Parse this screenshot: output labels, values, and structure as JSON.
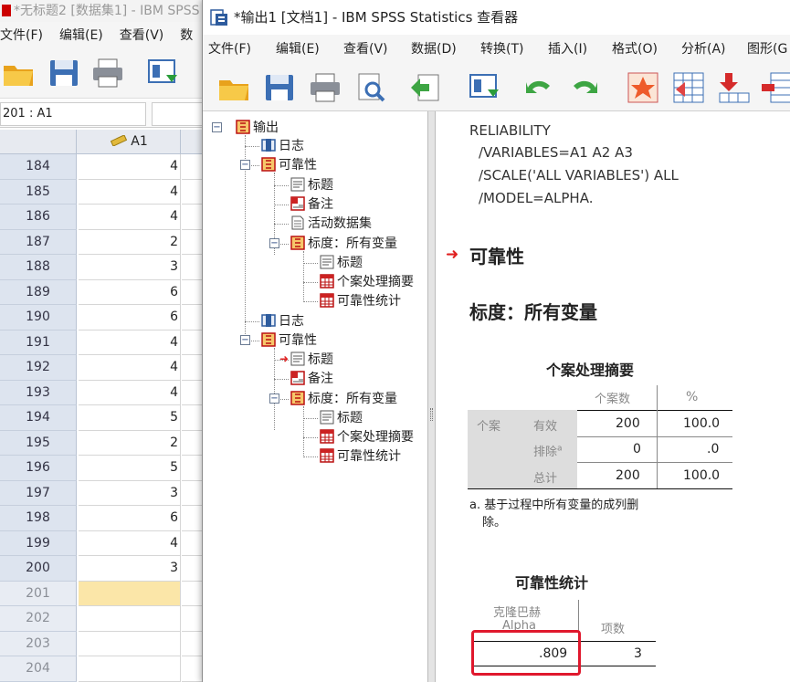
{
  "bg_window": {
    "title": "*无标题2 [数据集1] - IBM SPSS",
    "menu": [
      "文件(F)",
      "编辑(E)",
      "查看(V)",
      "数"
    ],
    "cell_ref": "201 : A1",
    "column_header": "A1",
    "rows": [
      {
        "n": "184",
        "v": "4"
      },
      {
        "n": "185",
        "v": "4"
      },
      {
        "n": "186",
        "v": "4"
      },
      {
        "n": "187",
        "v": "2"
      },
      {
        "n": "188",
        "v": "3"
      },
      {
        "n": "189",
        "v": "6"
      },
      {
        "n": "190",
        "v": "6"
      },
      {
        "n": "191",
        "v": "4"
      },
      {
        "n": "192",
        "v": "4"
      },
      {
        "n": "193",
        "v": "4"
      },
      {
        "n": "194",
        "v": "5"
      },
      {
        "n": "195",
        "v": "2"
      },
      {
        "n": "196",
        "v": "5"
      },
      {
        "n": "197",
        "v": "3"
      },
      {
        "n": "198",
        "v": "6"
      },
      {
        "n": "199",
        "v": "4"
      },
      {
        "n": "200",
        "v": "3"
      },
      {
        "n": "201",
        "v": ""
      },
      {
        "n": "202",
        "v": ""
      },
      {
        "n": "203",
        "v": ""
      },
      {
        "n": "204",
        "v": ""
      }
    ]
  },
  "viewer": {
    "title": "*输出1 [文档1] - IBM SPSS Statistics 查看器",
    "menu": [
      "文件(F)",
      "编辑(E)",
      "查看(V)",
      "数据(D)",
      "转换(T)",
      "插入(I)",
      "格式(O)",
      "分析(A)",
      "图形(G"
    ],
    "tree": {
      "root": "输出",
      "log1": "日志",
      "rel1": "可靠性",
      "title1": "标题",
      "notes1": "备注",
      "dataset1": "活动数据集",
      "scale1": "标度：所有变量",
      "title1b": "标题",
      "casesum1": "个案处理摘要",
      "relstat1": "可靠性统计",
      "log2": "日志",
      "rel2": "可靠性",
      "title2": "标题",
      "notes2": "备注",
      "scale2": "标度：所有变量",
      "title2b": "标题",
      "casesum2": "个案处理摘要",
      "relstat2": "可靠性统计"
    },
    "syntax": [
      "RELIABILITY",
      "/VARIABLES=A1 A2 A3",
      "/SCALE('ALL VARIABLES') ALL",
      "/MODEL=ALPHA."
    ],
    "heading_reliability": "可靠性",
    "heading_scale": "标度：所有变量",
    "case_table": {
      "title": "个案处理摘要",
      "col_n": "个案数",
      "col_pct": "%",
      "group": "个案",
      "rows": [
        {
          "label": "有效",
          "n": "200",
          "pct": "100.0"
        },
        {
          "label": "排除",
          "sup": "a",
          "n": "0",
          "pct": ".0"
        },
        {
          "label": "总计",
          "n": "200",
          "pct": "100.0"
        }
      ],
      "footnote_line1": "a. 基于过程中所有变量的成列删",
      "footnote_line2": "除。"
    },
    "rel_table": {
      "title": "可靠性统计",
      "col_alpha_1": "克隆巴赫",
      "col_alpha_2": "Alpha",
      "col_items": "项数",
      "alpha": ".809",
      "items": "3"
    }
  }
}
